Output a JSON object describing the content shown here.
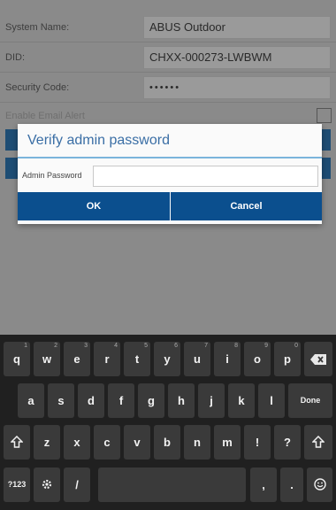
{
  "form": {
    "system_name_label": "System Name:",
    "system_name_value": "ABUS Outdoor",
    "did_label": "DID:",
    "did_value": "CHXX-000273-LWBWM",
    "security_code_label": "Security Code:",
    "security_code_value": "••••••",
    "email_alert_label": "Enable Email Alert"
  },
  "dialog": {
    "title": "Verify admin password",
    "password_label": "Admin Password",
    "password_value": "",
    "ok_label": "OK",
    "cancel_label": "Cancel"
  },
  "keyboard": {
    "row1": [
      {
        "k": "q",
        "s": "1"
      },
      {
        "k": "w",
        "s": "2"
      },
      {
        "k": "e",
        "s": "3"
      },
      {
        "k": "r",
        "s": "4"
      },
      {
        "k": "t",
        "s": "5"
      },
      {
        "k": "y",
        "s": "6"
      },
      {
        "k": "u",
        "s": "7"
      },
      {
        "k": "i",
        "s": "8"
      },
      {
        "k": "o",
        "s": "9"
      },
      {
        "k": "p",
        "s": "0"
      }
    ],
    "row2": [
      "a",
      "s",
      "d",
      "f",
      "g",
      "h",
      "j",
      "k",
      "l"
    ],
    "done_label": "Done",
    "row3": [
      "z",
      "x",
      "c",
      "v",
      "b",
      "n",
      "m",
      "!",
      "?"
    ],
    "symbols_label": "?123",
    "slash_label": "/",
    "comma_label": ",",
    "period_label": ".",
    "icons": {
      "backspace": "backspace-icon",
      "shift": "shift-icon",
      "settings": "settings-icon",
      "emoji": "emoji-icon"
    }
  }
}
